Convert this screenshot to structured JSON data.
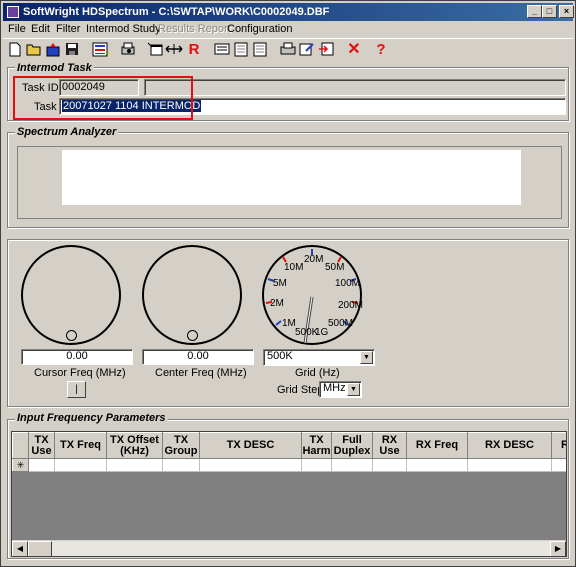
{
  "window": {
    "title": "SoftWright HDSpectrum - C:\\SWTAP\\WORK\\C0002049.DBF",
    "min_glyph": "_",
    "max_glyph": "□",
    "close_glyph": "×"
  },
  "menu": {
    "items": [
      "File",
      "Edit",
      "Filter",
      "Intermod Study",
      "Results Report",
      "Configuration"
    ]
  },
  "toolbar": {
    "icons": [
      "new-icon",
      "open-icon",
      "export-icon",
      "save-icon",
      "list-icon",
      "print-preview-icon",
      "window-icon",
      "arrows-icon",
      "r-icon",
      "report-icon",
      "page-icon",
      "page2-icon",
      "printer-icon",
      "edit-icon",
      "import-icon",
      "delete-icon",
      "help-icon"
    ],
    "r_glyph": "R",
    "delete_glyph": "✕",
    "help_glyph": "?"
  },
  "intermod_task": {
    "legend": "Intermod Task",
    "task_id_label": "Task ID:",
    "task_id_value": "0002049",
    "task_label": "Task",
    "task_value": "20071027 1104 INTERMOD"
  },
  "spectrum_analyzer": {
    "legend": "Spectrum Analyzer"
  },
  "controls": {
    "cursor_freq_value": "0.00",
    "cursor_freq_label": "Cursor Freq (MHz)",
    "center_freq_value": "0.00",
    "center_freq_label": "Center Freq (MHz)",
    "cursor_button_label": "|",
    "grid_value": "500K",
    "grid_label": "Grid (Hz)",
    "grid_step_label": "Grid Step",
    "grid_step_value": "MHz",
    "grid_dial_labels": [
      "20M",
      "50M",
      "10M",
      "100M",
      "5M",
      "200M",
      "2M",
      "500M",
      "1M",
      "500K",
      "1G"
    ]
  },
  "input_frequency": {
    "legend": "Input Frequency Parameters",
    "columns": [
      "",
      "TX Use",
      "TX Freq",
      "TX Offset (KHz)",
      "TX Group",
      "TX DESC",
      "TX Harm",
      "Full Duplex",
      "RX Use",
      "RX Freq",
      "RX DESC",
      "R"
    ],
    "new_row_marker": "✳"
  },
  "colors": {
    "highlight": "#e01010",
    "selection": "#0a246a",
    "face": "#d4d0c8"
  }
}
